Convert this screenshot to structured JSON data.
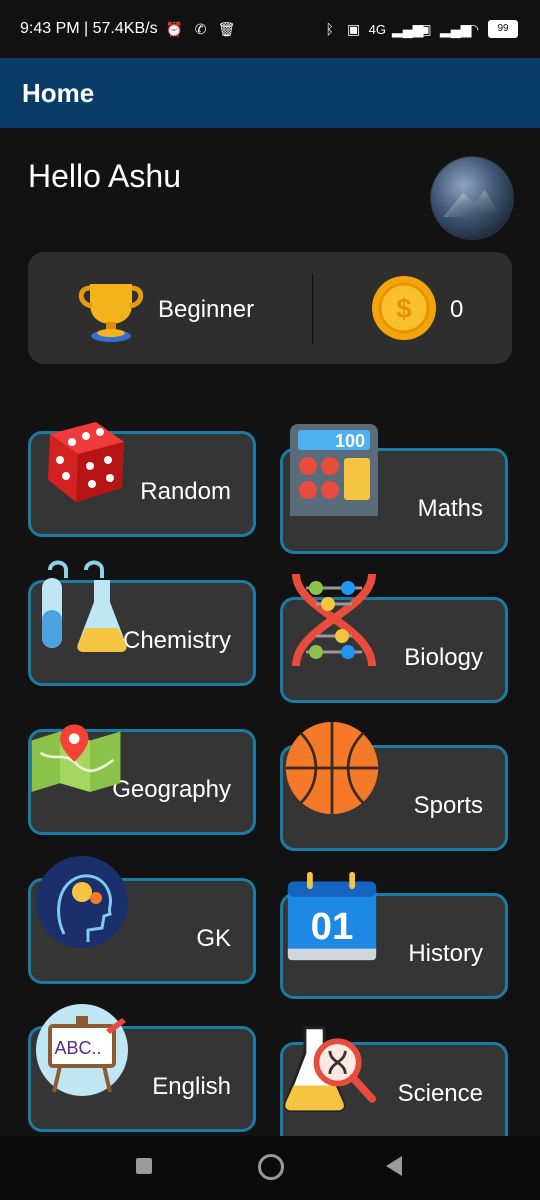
{
  "status_bar": {
    "time_speed": "9:43 PM | 57.4KB/s",
    "network_label": "4G",
    "battery": "99"
  },
  "app_bar": {
    "title": "Home"
  },
  "greeting": "Hello Ashu",
  "stats": {
    "level": "Beginner",
    "coins": "0"
  },
  "categories": [
    {
      "label": "Random"
    },
    {
      "label": "Maths"
    },
    {
      "label": "Chemistry"
    },
    {
      "label": "Biology"
    },
    {
      "label": "Geography"
    },
    {
      "label": "Sports"
    },
    {
      "label": "GK"
    },
    {
      "label": "History"
    },
    {
      "label": "English"
    },
    {
      "label": "Science"
    }
  ],
  "icons": {
    "maths_display": "100",
    "history_calendar": "01",
    "english_board": "ABC.."
  },
  "colors": {
    "app_bar": "#0a3c68",
    "card_border": "#1a7ca3",
    "card_bg": "#353535",
    "background": "#121212"
  }
}
